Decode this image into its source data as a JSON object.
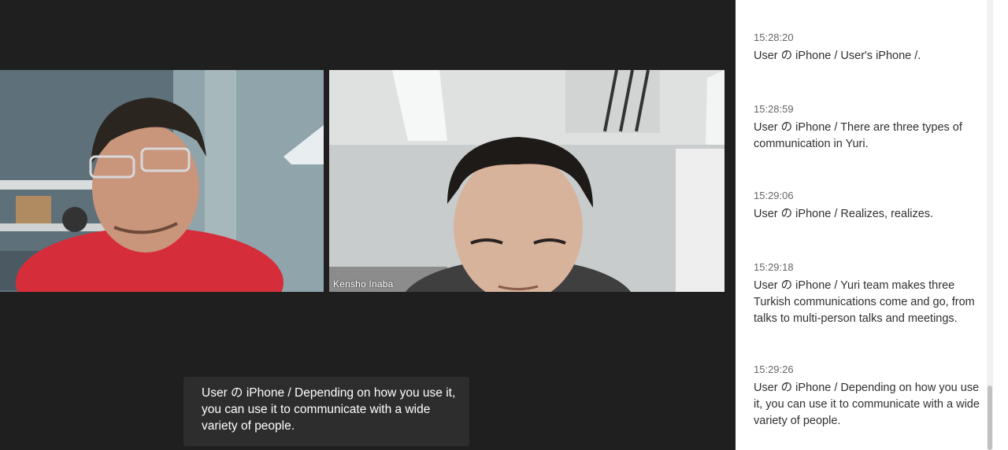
{
  "participants": [
    {
      "name": ""
    },
    {
      "name": "Kensho Inaba"
    }
  ],
  "live_caption": {
    "text": "User の iPhone / Depending on how you use it, you can use it to communicate with a wide variety of people."
  },
  "transcript": [
    {
      "time": "15:28:20",
      "text": "User の iPhone / User's iPhone /."
    },
    {
      "time": "15:28:59",
      "text": "User の iPhone / There are three types of communication in Yuri."
    },
    {
      "time": "15:29:06",
      "text": "User の iPhone / Realizes, realizes."
    },
    {
      "time": "15:29:18",
      "text": "User の iPhone / Yuri team makes three Turkish communications come and go, from talks to multi-person talks and meetings."
    },
    {
      "time": "15:29:26",
      "text": "User の iPhone / Depending on how you use it, you can use it to communicate with a wide variety of people."
    }
  ],
  "colors": {
    "stage_bg": "#1f1f1f",
    "panel_bg": "#ffffff",
    "caption_bg": "#2d2d2d"
  }
}
